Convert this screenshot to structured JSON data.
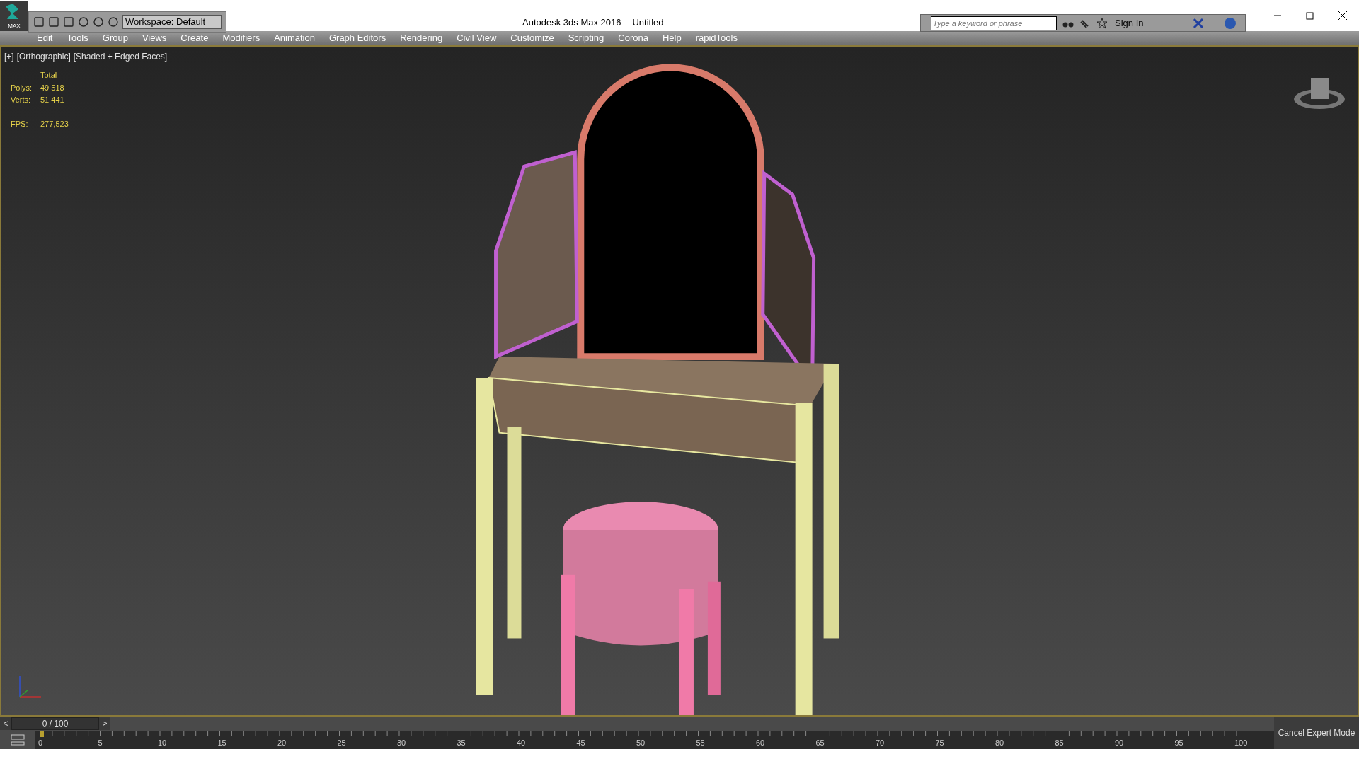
{
  "title_bar": {
    "app_title": "Autodesk 3ds Max 2016",
    "document": "Untitled",
    "workspace": "Workspace: Default",
    "search": {
      "placeholder": "Type a keyword or phrase"
    },
    "sign_in": "Sign In"
  },
  "app_button": {
    "label": "MAX"
  },
  "menu": [
    "Edit",
    "Tools",
    "Group",
    "Views",
    "Create",
    "Modifiers",
    "Animation",
    "Graph Editors",
    "Rendering",
    "Civil View",
    "Customize",
    "Scripting",
    "Corona",
    "Help",
    "rapidTools"
  ],
  "viewport": {
    "labels": [
      "[+]",
      "[Orthographic]",
      "[Shaded + Edged Faces]"
    ],
    "stats": {
      "heading": "Total",
      "rows": [
        {
          "label": "Polys:",
          "value": "49 518"
        },
        {
          "label": "Verts:",
          "value": "51 441"
        }
      ],
      "fps_label": "FPS:",
      "fps_value": "277,523"
    }
  },
  "time_slider": {
    "frame": "0 / 100",
    "level": 0,
    "prev": "<",
    "next": ">"
  },
  "track_bar": {
    "labels": [
      "0",
      "5",
      "10",
      "15",
      "20",
      "25",
      "30",
      "35",
      "40",
      "45",
      "50",
      "55",
      "60",
      "65",
      "70",
      "75",
      "80",
      "85",
      "90",
      "95",
      "100"
    ]
  },
  "status": {
    "button": "Cancel Expert Mode"
  }
}
